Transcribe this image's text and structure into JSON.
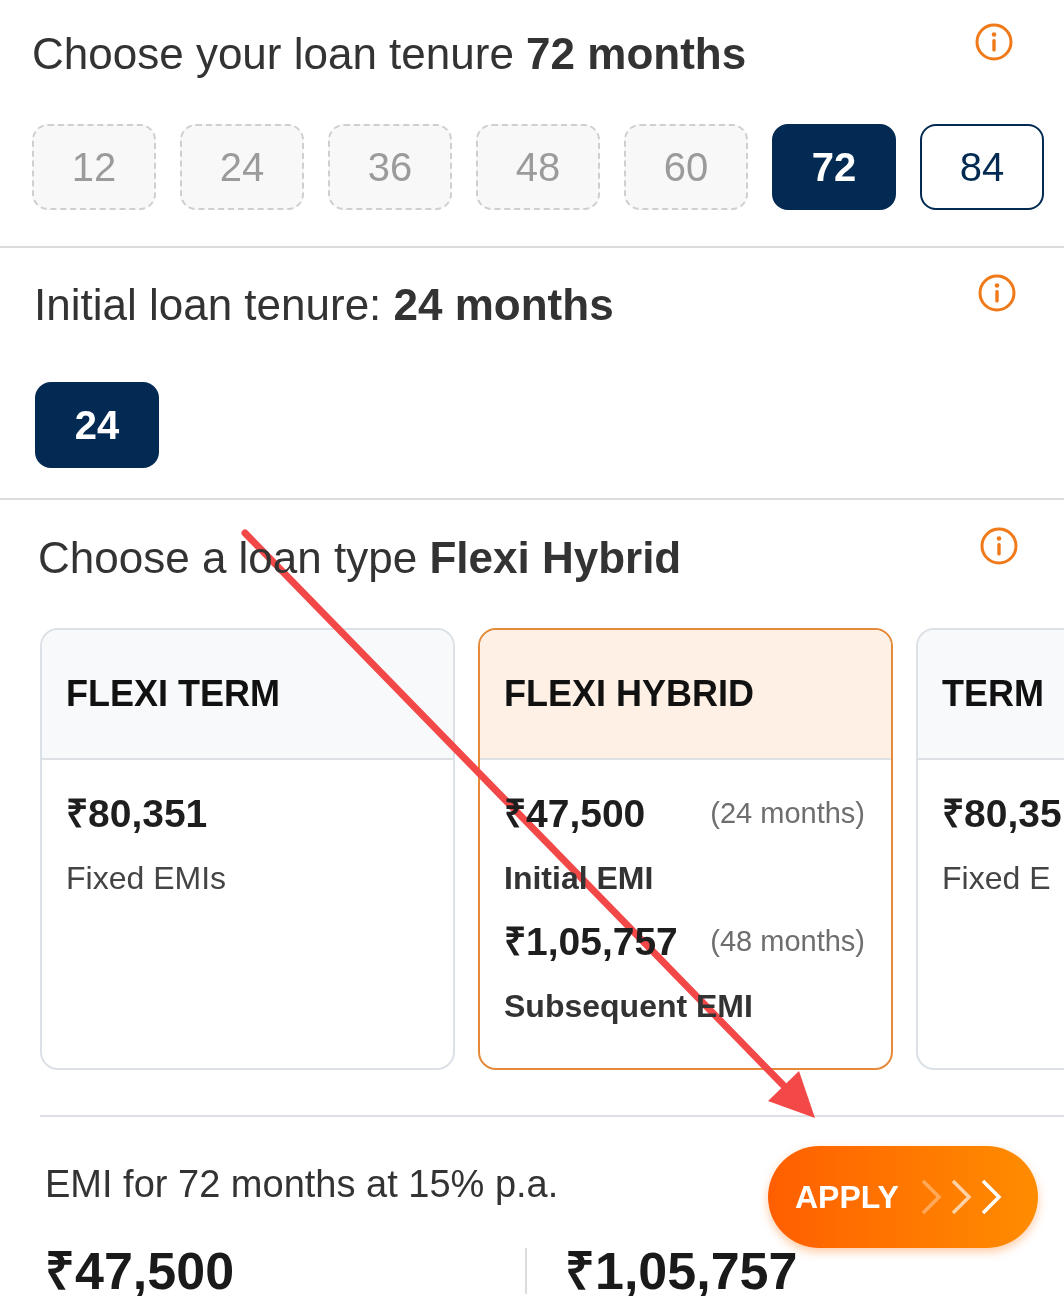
{
  "tenure": {
    "title": "Choose your loan tenure **72 months**",
    "options": [
      {
        "label": "12",
        "selected": false,
        "disabled": true
      },
      {
        "label": "24",
        "selected": false,
        "disabled": true
      },
      {
        "label": "36",
        "selected": false,
        "disabled": true
      },
      {
        "label": "48",
        "selected": false,
        "disabled": true
      },
      {
        "label": "60",
        "selected": false,
        "disabled": true
      },
      {
        "label": "72",
        "selected": true,
        "disabled": false
      },
      {
        "label": "84",
        "selected": false,
        "disabled": false
      }
    ]
  },
  "initial_tenure": {
    "title": "Initial loan tenure: **24 months**",
    "options": [
      {
        "label": "24",
        "selected": true,
        "disabled": false
      }
    ]
  },
  "loan_type": {
    "title": "Choose a loan type **Flexi Hybrid**",
    "cards": [
      {
        "title": "FLEXI TERM",
        "selected": false,
        "rows": [
          {
            "amount": "₹80,351",
            "label": "Fixed EMIs"
          }
        ]
      },
      {
        "title": "FLEXI HYBRID",
        "selected": true,
        "rows": [
          {
            "amount": "₹47,500",
            "period": "(24 months)",
            "label": "Initial EMI"
          },
          {
            "amount": "₹1,05,757",
            "period": "(48 months)",
            "label": "Subsequent EMI"
          }
        ]
      },
      {
        "title": "TERM",
        "selected": false,
        "rows": [
          {
            "amount": "₹80,35",
            "label": "Fixed E"
          }
        ]
      }
    ]
  },
  "summary": {
    "text": "EMI for 72 months at 15% p.a.",
    "apply_button": "APPLY",
    "amounts": [
      "₹47,500",
      "₹1,05,757"
    ]
  }
}
